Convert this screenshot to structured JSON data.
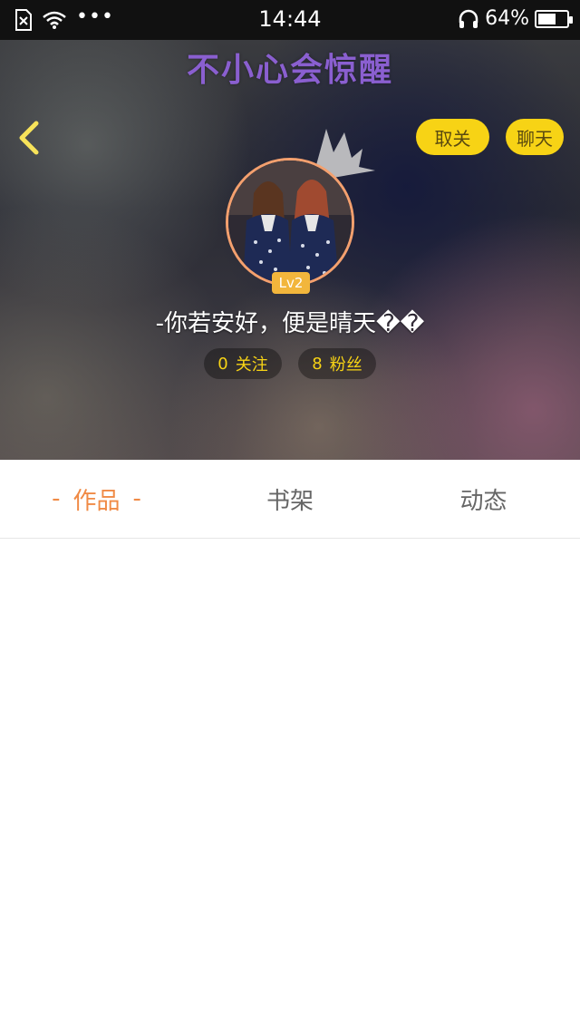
{
  "status_bar": {
    "time": "14:44",
    "battery_percent_label": "64%",
    "battery_level": 0.64,
    "icons": [
      "sim-none-icon",
      "wifi-icon",
      "more-dots-icon",
      "headphones-icon",
      "battery-icon"
    ]
  },
  "header": {
    "title": "不小心会惊醒",
    "follow_button": "取关",
    "chat_button": "聊天",
    "level": "Lv2",
    "username": "-你若安好，便是晴天��",
    "following": {
      "count": "0",
      "label": "关注"
    },
    "fans": {
      "count": "8",
      "label": "粉丝"
    }
  },
  "tabs": [
    {
      "label": "作品",
      "active": true
    },
    {
      "label": "书架",
      "active": false
    },
    {
      "label": "动态",
      "active": false
    }
  ],
  "colors": {
    "accent_orange": "#f08a45",
    "button_yellow": "#f7d315",
    "title_purple": "#8a5fd0",
    "level_badge": "#f2b63c"
  }
}
